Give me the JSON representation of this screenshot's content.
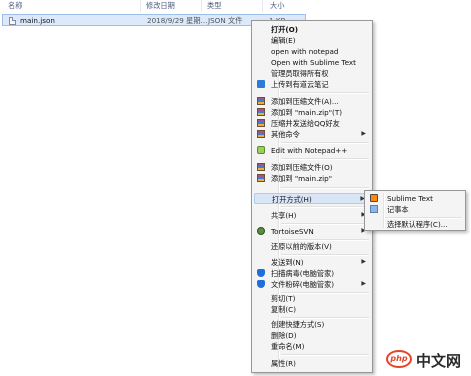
{
  "columns": {
    "name": "名称",
    "date": "修改日期",
    "type": "类型",
    "size": "大小"
  },
  "file": {
    "name": "main.json",
    "date": "2018/9/29 星期...",
    "type": "JSON 文件",
    "size": "1 KB"
  },
  "context_menu": {
    "open": "打开(O)",
    "edit": "编辑(E)",
    "open_notepad": "open with notepad",
    "open_sublime": "Open with Sublime Text",
    "admin": "管理员取得所有权",
    "youdao": "上传到有道云笔记",
    "add_archive": "添加到压缩文件(A)...",
    "add_zip": "添加到 \"main.zip\"(T)",
    "zip_qq": "压缩并发送给QQ好友",
    "other_cmd": "其他命令",
    "edit_npp": "Edit with Notepad++",
    "add_archive2": "添加到压缩文件(O)",
    "add_zip2": "添加到 \"main.zip\"",
    "open_with": "打开方式(H)",
    "share": "共享(H)",
    "tortoise": "TortoiseSVN",
    "restore": "还原以前的版本(V)",
    "send_to": "发送到(N)",
    "scan": "扫描病毒(电脑管家)",
    "shred": "文件粉碎(电脑管家)",
    "cut": "剪切(T)",
    "copy": "复制(C)",
    "shortcut": "创建快捷方式(S)",
    "delete": "删除(D)",
    "rename": "重命名(M)",
    "props": "属性(R)"
  },
  "submenu": {
    "sublime": "Sublime Text",
    "notepad": "记事本",
    "choose": "选择默认程序(C)..."
  },
  "watermark": {
    "logo": "php",
    "text": "中文网"
  }
}
